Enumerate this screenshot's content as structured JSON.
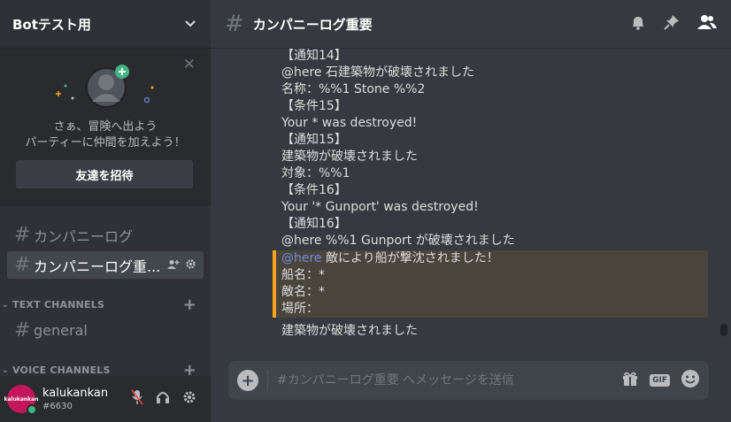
{
  "server": {
    "name": "Botテスト用"
  },
  "invite": {
    "line1": "さぁ、冒険へ出よう",
    "line2": "パーティーに仲間を加えよう！",
    "button": "友達を招待"
  },
  "channels": {
    "top": [
      {
        "label": "カンパニーログ"
      },
      {
        "label": "カンパニーログ重..."
      }
    ],
    "text_category": "TEXT CHANNELS",
    "text": [
      {
        "label": "general"
      }
    ],
    "voice_category": "VOICE CHANNELS"
  },
  "user": {
    "name": "kalukankan",
    "tag": "#6630",
    "avatar_text": "kalukankan"
  },
  "header": {
    "channel": "カンパニーログ重要"
  },
  "messages": [
    "【通知14】",
    "@here 石建築物が破壊されました",
    "名称：%%1 Stone %%2",
    "【条件15】",
    "Your * was destroyed!",
    "【通知15】",
    "建築物が破壊されました",
    "対象：%%1",
    "【条件16】",
    "Your '* Gunport' was destroyed!",
    "【通知16】",
    "@here %%1 Gunport が破壊されました"
  ],
  "highlight": {
    "mention": "@here",
    "line1_rest": " 敵により船が撃沈されました！",
    "line2": "船名：*",
    "line3": "敵名：*",
    "line4": "場所："
  },
  "last_message": "建築物が破壊されました",
  "composer": {
    "placeholder": "#カンパニーログ重要 へメッセージを送信",
    "gif": "GIF"
  },
  "colors": {
    "accent": "#faa61a",
    "mention": "#7289da",
    "online": "#43b581"
  }
}
